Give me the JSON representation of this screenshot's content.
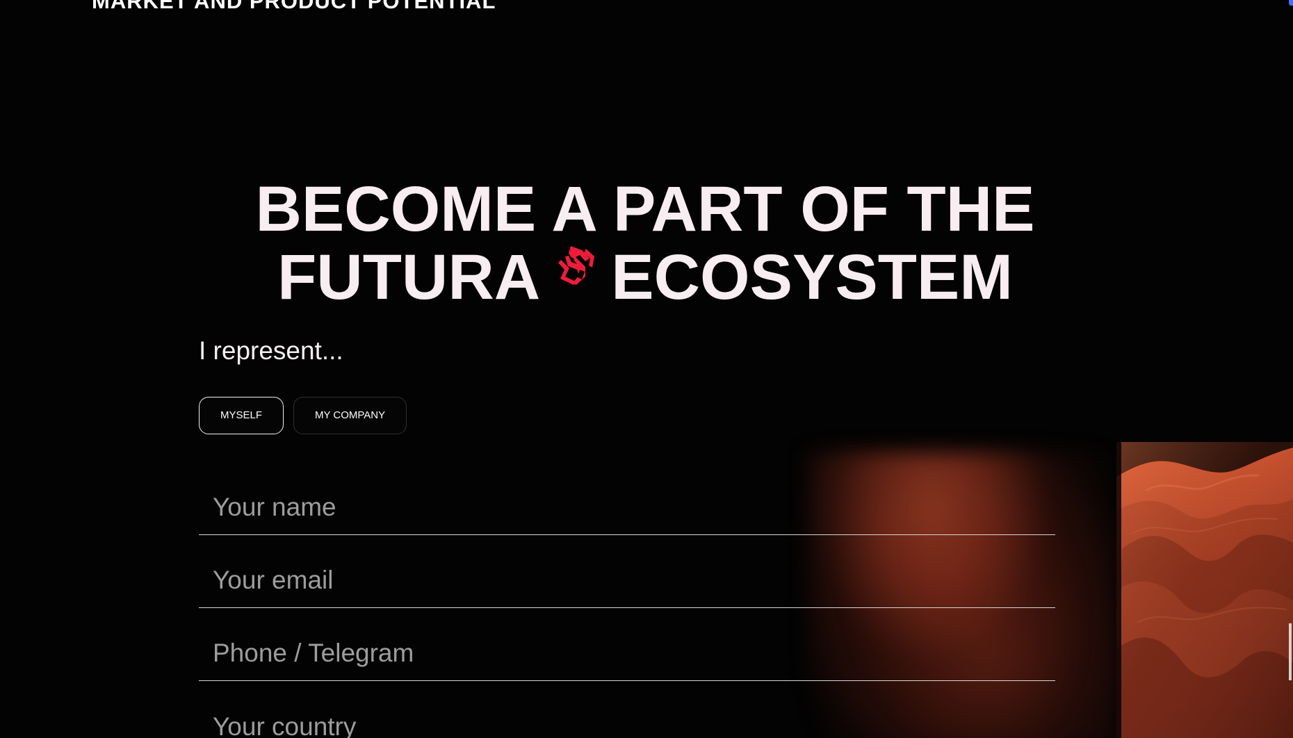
{
  "section": {
    "top_title": "MARKET AND PRODUCT POTENTIAL"
  },
  "hero": {
    "line_1": "BECOME A PART OF THE",
    "line_2_left": "FUTURA",
    "line_2_right": "ECOSYSTEM",
    "mark_icon": "futura-ecosystem-icon",
    "mark_color": "#ed1d3a"
  },
  "form": {
    "represent_label": "I represent...",
    "choices": [
      {
        "label": "MYSELF",
        "selected": true
      },
      {
        "label": "MY COMPANY",
        "selected": false
      }
    ],
    "fields": {
      "name_placeholder": "Your name",
      "email_placeholder": "Your email",
      "phone_placeholder": "Phone / Telegram",
      "country_placeholder": "Your country"
    }
  },
  "background": {
    "image_name": "red-rock-canyon",
    "accent_color": "#b5452c"
  }
}
